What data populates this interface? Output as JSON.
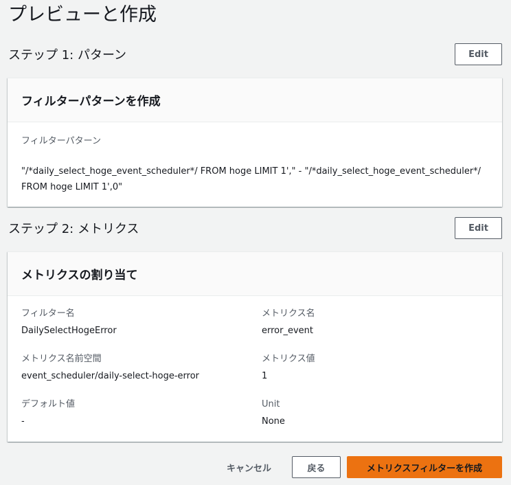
{
  "page": {
    "title": "プレビューと作成"
  },
  "step1": {
    "title": "ステップ 1: パターン",
    "edit_label": "Edit",
    "panel_title": "フィルターパターンを作成",
    "pattern_label": "フィルターパターン",
    "pattern_value_line1": "\"/*daily_select_hoge_event_scheduler*/ FROM hoge LIMIT 1',\" - \"/*daily_select_hoge_event_scheduler*/",
    "pattern_value_line2": "FROM hoge LIMIT 1',0\""
  },
  "step2": {
    "title": "ステップ 2: メトリクス",
    "edit_label": "Edit",
    "panel_title": "メトリクスの割り当て",
    "fields": [
      {
        "label": "フィルター名",
        "value": "DailySelectHogeError"
      },
      {
        "label": "メトリクス名",
        "value": "error_event"
      },
      {
        "label": "メトリクス名前空間",
        "value": "event_scheduler/daily-select-hoge-error"
      },
      {
        "label": "メトリクス値",
        "value": "1"
      },
      {
        "label": "デフォルト値",
        "value": "-"
      },
      {
        "label": "Unit",
        "value": "None"
      }
    ]
  },
  "footer": {
    "cancel_label": "キャンセル",
    "back_label": "戻る",
    "create_label": "メトリクスフィルターを作成"
  },
  "colors": {
    "primary": "#ec7211",
    "background": "#f2f3f3",
    "border": "#545b64"
  }
}
